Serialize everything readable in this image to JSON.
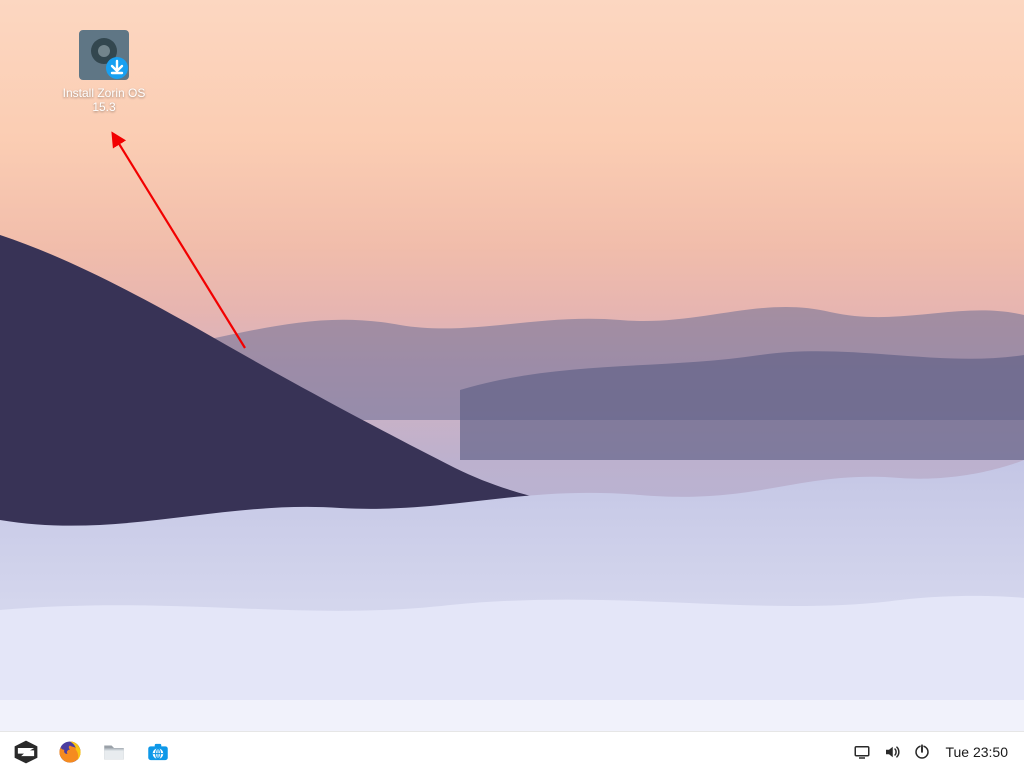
{
  "desktop": {
    "installer_icon_label": "Install Zorin OS 15.3"
  },
  "taskbar": {
    "menu_icon": "zorin-menu-icon",
    "apps": {
      "firefox": "firefox-icon",
      "files": "files-icon",
      "software": "software-icon"
    },
    "tray": {
      "display": "display-icon",
      "volume": "volume-icon",
      "power": "power-icon"
    },
    "clock_text": "Tue 23:50"
  }
}
